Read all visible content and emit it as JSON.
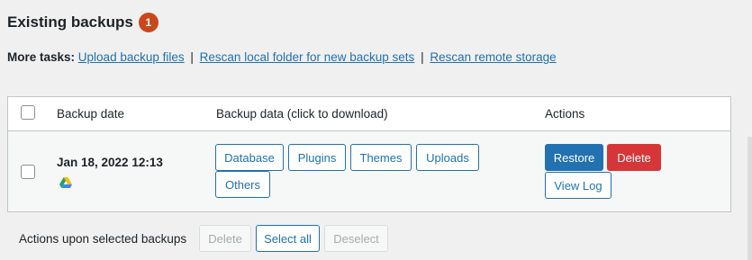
{
  "header": {
    "title": "Existing backups",
    "badge_count": "1"
  },
  "more_tasks": {
    "label": "More tasks:",
    "links": [
      "Upload backup files",
      "Rescan local folder for new backup sets",
      "Rescan remote storage"
    ],
    "separator": "|"
  },
  "table": {
    "columns": {
      "date": "Backup date",
      "data": "Backup data (click to download)",
      "actions": "Actions"
    },
    "rows": [
      {
        "date": "Jan 18, 2022 12:13",
        "storage_icon": "google-drive-icon",
        "data_buttons": [
          "Database",
          "Plugins",
          "Themes",
          "Uploads",
          "Others"
        ],
        "actions": {
          "restore": "Restore",
          "delete": "Delete",
          "view_log": "View Log"
        }
      }
    ]
  },
  "bulk_actions": {
    "label": "Actions upon selected backups",
    "delete": "Delete",
    "select_all": "Select all",
    "deselect": "Deselect"
  },
  "colors": {
    "accent": "#2271b1",
    "badge": "#c9471b",
    "danger": "#d63638"
  }
}
